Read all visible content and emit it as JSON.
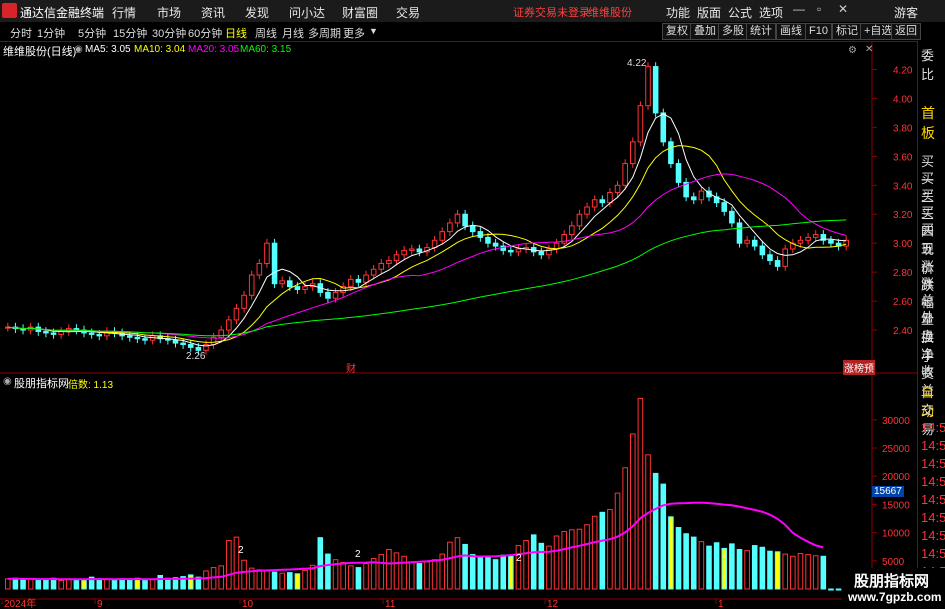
{
  "app": {
    "name": "通达信金融终端",
    "menu": [
      "行情",
      "市场",
      "资讯",
      "发现",
      "问小达",
      "财富圈",
      "交易"
    ],
    "status_red": "证券交易未登录",
    "status_stock": "维维股份",
    "right_menu": [
      "功能",
      "版面",
      "公式",
      "选项"
    ],
    "user": "游客"
  },
  "toolbar": {
    "periods": [
      "分时",
      "1分钟",
      "5分钟",
      "15分钟",
      "30分钟",
      "60分钟",
      "日线",
      "周线",
      "月线",
      "多周期",
      "更多"
    ],
    "active": "日线",
    "right_buttons": [
      "复权",
      "叠加",
      "多股",
      "统计",
      "画线",
      "F10",
      "标记",
      "+自选",
      "返回"
    ]
  },
  "main_chart": {
    "title": "维维股份(日线)",
    "ma": [
      {
        "label": "MA5: 3.05",
        "color": "#ffffff"
      },
      {
        "label": "MA10: 3.04",
        "color": "#ffff00"
      },
      {
        "label": "MA20: 3.05",
        "color": "#ff00ff"
      },
      {
        "label": "MA60: 3.15",
        "color": "#00ff00"
      }
    ],
    "high_label": "4.22",
    "low_label": "2.26",
    "y_ticks": [
      "4.20",
      "4.00",
      "3.80",
      "3.60",
      "3.40",
      "3.20",
      "3.00",
      "2.80",
      "2.60",
      "2.40"
    ],
    "marker_cai": "财",
    "marker_zt": "涨榜预"
  },
  "sub_chart": {
    "title": "股朋指标网",
    "param": "倍数: 1.13",
    "y_ticks": [
      "30000",
      "25000",
      "20000",
      "15000",
      "10000",
      "5000"
    ],
    "current_value": "15667",
    "mark_labels": [
      "2",
      "2",
      "2"
    ]
  },
  "x_axis": [
    "2024年",
    "9",
    "10",
    "11",
    "12",
    "1"
  ],
  "side": [
    "委比",
    "首板",
    "买一",
    "买二",
    "买三",
    "买四",
    "买五",
    "现价",
    "涨跌",
    "涨幅",
    "总量",
    "外盘",
    "换手",
    "净资",
    "收益",
    "自动",
    "交易",
    "14:56",
    "14:56",
    "14:56",
    "14:56",
    "14:56",
    "14:56",
    "14:56",
    "14:56",
    "14:56"
  ],
  "watermark": {
    "line1": "股朋指标网",
    "line2": "www.7gpzb.com"
  },
  "colors": {
    "up": "#ff3333",
    "down": "#54ffff",
    "ma5": "#ffffff",
    "ma10": "#ffff00",
    "ma20": "#ff00ff",
    "ma60": "#00ff00",
    "bg": "#000000"
  },
  "chart_data": {
    "type": "candlestick+volume",
    "price_range": [
      2.2,
      4.3
    ],
    "candles_close": [
      2.42,
      2.41,
      2.4,
      2.42,
      2.39,
      2.38,
      2.37,
      2.39,
      2.41,
      2.4,
      2.38,
      2.37,
      2.36,
      2.39,
      2.38,
      2.36,
      2.35,
      2.34,
      2.33,
      2.36,
      2.34,
      2.33,
      2.31,
      2.3,
      2.28,
      2.26,
      2.3,
      2.35,
      2.4,
      2.47,
      2.55,
      2.64,
      2.78,
      2.86,
      3.0,
      2.72,
      2.74,
      2.7,
      2.68,
      2.7,
      2.72,
      2.66,
      2.62,
      2.66,
      2.7,
      2.75,
      2.73,
      2.78,
      2.82,
      2.86,
      2.88,
      2.92,
      2.95,
      2.96,
      2.94,
      2.97,
      3.02,
      3.08,
      3.14,
      3.2,
      3.12,
      3.08,
      3.04,
      3.0,
      2.98,
      2.95,
      2.94,
      2.96,
      2.97,
      2.94,
      2.92,
      2.96,
      3.0,
      3.06,
      3.12,
      3.2,
      3.25,
      3.3,
      3.28,
      3.35,
      3.4,
      3.55,
      3.7,
      3.95,
      4.22,
      3.9,
      3.7,
      3.55,
      3.42,
      3.32,
      3.3,
      3.36,
      3.32,
      3.28,
      3.22,
      3.14,
      3.0,
      3.02,
      2.98,
      2.92,
      2.88,
      2.84,
      2.96,
      3.0,
      3.02,
      3.04,
      3.06,
      3.02,
      3.0,
      2.98,
      3.02
    ],
    "volume": [
      1800,
      1900,
      1700,
      1800,
      1600,
      1700,
      1900,
      1500,
      1800,
      1700,
      1600,
      2100,
      1800,
      1700,
      1600,
      1800,
      1700,
      1900,
      1500,
      1700,
      2400,
      1900,
      2000,
      2200,
      2500,
      2100,
      3200,
      3800,
      4100,
      8600,
      9200,
      5100,
      3700,
      3400,
      3200,
      3000,
      2800,
      2900,
      2700,
      3300,
      4200,
      9100,
      6200,
      5200,
      4700,
      4100,
      3800,
      4500,
      5400,
      6100,
      7000,
      6400,
      5800,
      4700,
      4500,
      4800,
      5200,
      6200,
      8300,
      9100,
      7900,
      6100,
      5500,
      5700,
      5200,
      6000,
      5800,
      7700,
      8600,
      9600,
      8100,
      7600,
      9400,
      10200,
      10500,
      10600,
      11400,
      12900,
      13600,
      14100,
      17000,
      21500,
      27500,
      33800,
      23800,
      20500,
      18600,
      12800,
      10900,
      9800,
      9200,
      8400,
      7600,
      8200,
      7200,
      8000,
      7000,
      6800,
      7700,
      7400,
      6700,
      6600,
      6200,
      5800,
      6300,
      6100,
      5900,
      5800
    ]
  }
}
